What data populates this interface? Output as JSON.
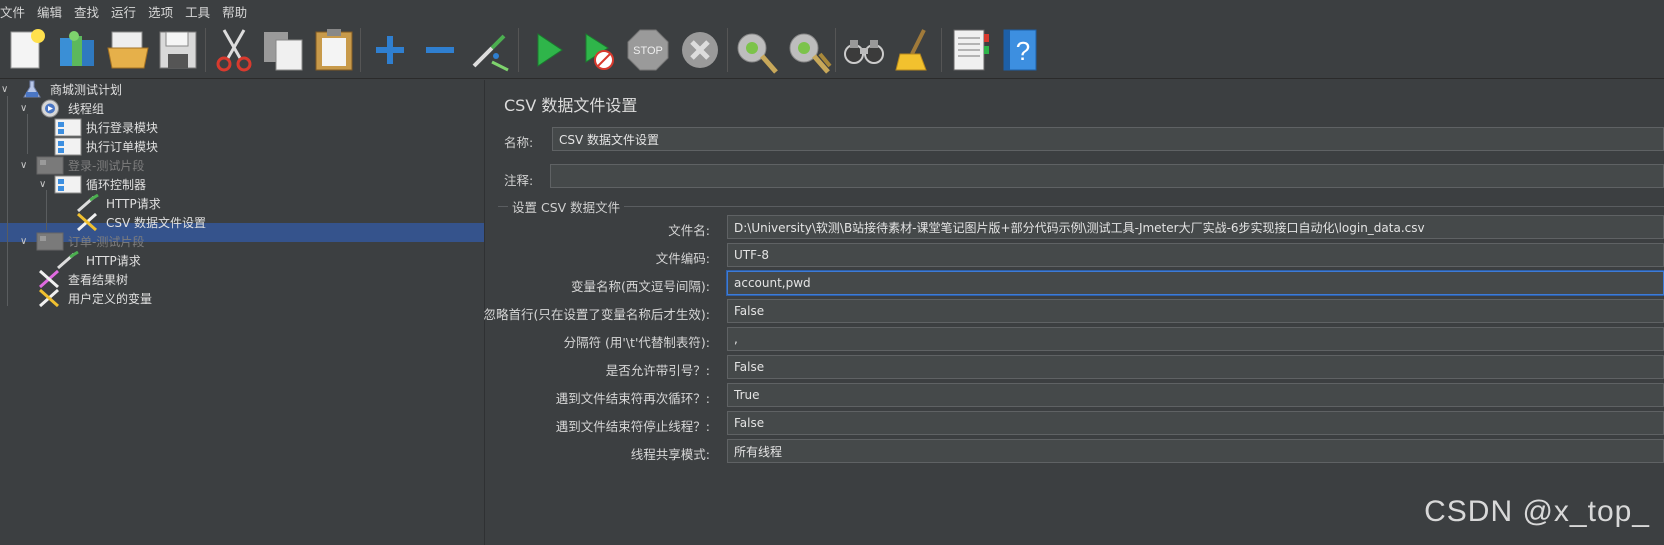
{
  "menu": [
    "文件",
    "编辑",
    "查找",
    "运行",
    "选项",
    "工具",
    "帮助"
  ],
  "toolbar_icons": [
    "new-icon",
    "templates-icon",
    "open-icon",
    "save-icon",
    "cut-icon",
    "copy-icon",
    "paste-icon",
    "add-icon",
    "remove-icon",
    "toggle-icon",
    "start-icon",
    "start-no-pauses-icon",
    "stop-icon",
    "shutdown-icon",
    "clear-icon",
    "clear-all-icon",
    "search-icon",
    "reset-search-icon",
    "function-helper-icon",
    "help-icon"
  ],
  "tree": {
    "items": [
      {
        "label": "商城测试计划"
      },
      {
        "label": "线程组"
      },
      {
        "label": "执行登录模块"
      },
      {
        "label": "执行订单模块"
      },
      {
        "label": "登录-测试片段"
      },
      {
        "label": "循环控制器"
      },
      {
        "label": "HTTP请求"
      },
      {
        "label": "CSV 数据文件设置"
      },
      {
        "label": "订单-测试片段"
      },
      {
        "label": "HTTP请求"
      },
      {
        "label": "查看结果树"
      },
      {
        "label": "用户定义的变量"
      }
    ]
  },
  "panel": {
    "title": "CSV 数据文件设置",
    "name_label": "名称:",
    "name_value": "CSV 数据文件设置",
    "comment_label": "注释:",
    "comment_value": "",
    "group_title": "设置 CSV 数据文件",
    "fields": [
      {
        "label": "文件名:",
        "value": "D:\\University\\软测\\B站接待素材-课堂笔记图片版+部分代码示例\\测试工具-Jmeter大厂实战-6步实现接口自动化\\login_data.csv"
      },
      {
        "label": "文件编码:",
        "value": "UTF-8"
      },
      {
        "label": "变量名称(西文逗号间隔):",
        "value": "account,pwd"
      },
      {
        "label": "忽略首行(只在设置了变量名称后才生效):",
        "value": "False"
      },
      {
        "label": "分隔符 (用'\\t'代替制表符):",
        "value": ","
      },
      {
        "label": "是否允许带引号？:",
        "value": "False"
      },
      {
        "label": "遇到文件结束符再次循环？:",
        "value": "True"
      },
      {
        "label": "遇到文件结束符停止线程？:",
        "value": "False"
      },
      {
        "label": "线程共享模式:",
        "value": "所有线程"
      }
    ]
  },
  "watermark": "CSDN @x_top_",
  "colors": {
    "background": "#3c3f41",
    "selection": "#2f65ca",
    "field": "#45494a",
    "focus": "#3d7bd6"
  }
}
